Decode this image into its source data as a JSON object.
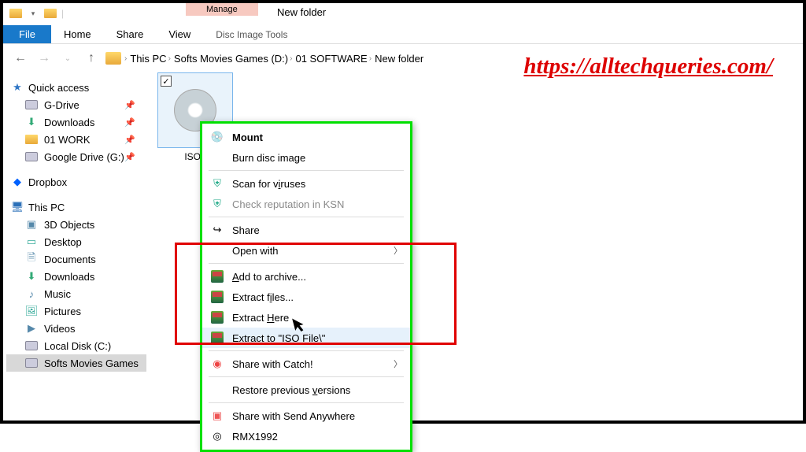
{
  "titlebar": {
    "manage_label": "Manage",
    "window_title": "New folder"
  },
  "ribbon": {
    "file": "File",
    "home": "Home",
    "share": "Share",
    "view": "View",
    "disc_image_tools": "Disc Image Tools"
  },
  "breadcrumb": {
    "items": [
      "This PC",
      "Softs Movies Games (D:)",
      "01 SOFTWARE",
      "New folder"
    ]
  },
  "watermark": "https://alltechqueries.com/",
  "sidebar": {
    "quick_access": "Quick access",
    "quick_items": [
      {
        "label": "G-Drive",
        "pinned": true
      },
      {
        "label": "Downloads",
        "pinned": true
      },
      {
        "label": "01 WORK",
        "pinned": true
      },
      {
        "label": "Google Drive (G:)",
        "pinned": true
      }
    ],
    "dropbox": "Dropbox",
    "this_pc": "This PC",
    "pc_items": [
      {
        "label": "3D Objects"
      },
      {
        "label": "Desktop"
      },
      {
        "label": "Documents"
      },
      {
        "label": "Downloads"
      },
      {
        "label": "Music"
      },
      {
        "label": "Pictures"
      },
      {
        "label": "Videos"
      },
      {
        "label": "Local Disk (C:)"
      },
      {
        "label": "Softs Movies Games"
      }
    ]
  },
  "file": {
    "name": "ISO F"
  },
  "context_menu": {
    "mount": "Mount",
    "burn": "Burn disc image",
    "scan": "Scan for viruses",
    "ksn": "Check reputation in KSN",
    "share": "Share",
    "open_with": "Open with",
    "add_archive": "Add to archive...",
    "extract_files": "Extract files...",
    "extract_here": "Extract Here",
    "extract_to": "Extract to \"ISO File\\\"",
    "share_catch": "Share with Catch!",
    "restore": "Restore previous versions",
    "send_anywhere": "Share with Send Anywhere",
    "rmx": "RMX1992"
  }
}
